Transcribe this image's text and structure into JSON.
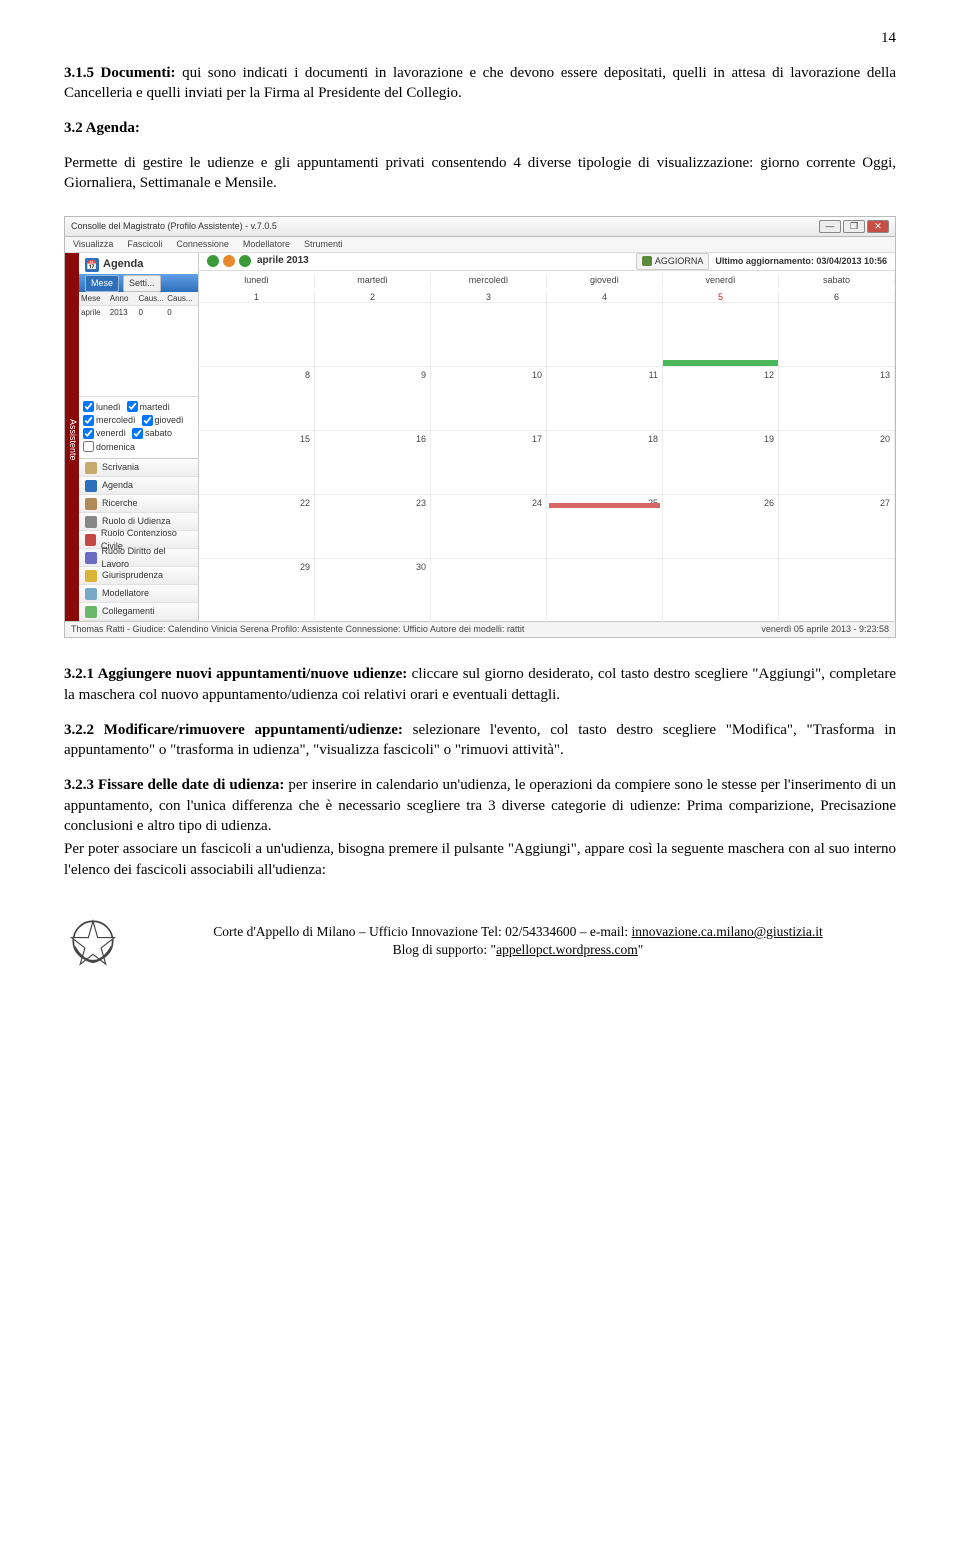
{
  "page_number": "14",
  "s315": {
    "title": "3.1.5 Documenti:",
    "text": " qui sono indicati i documenti in lavorazione e che devono essere depositati, quelli in attesa di lavorazione della Cancelleria e quelli inviati per la Firma al Presidente del Collegio."
  },
  "s32": {
    "title": "3.2 Agenda:",
    "text": "Permette di gestire le udienze e gli appuntamenti privati consentendo 4 diverse tipologie di visualizzazione: giorno corrente Oggi, Giornaliera, Settimanale e Mensile."
  },
  "s321": {
    "title": "3.2.1 Aggiungere nuovi appuntamenti/nuove udienze:",
    "text": " cliccare sul giorno desiderato, col tasto destro scegliere \"Aggiungi\", completare la maschera col nuovo appuntamento/udienza coi relativi orari e eventuali dettagli."
  },
  "s322": {
    "title": "3.2.2 Modificare/rimuovere appuntamenti/udienze:",
    "text": " selezionare l'evento, col tasto destro scegliere \"Modifica\", \"Trasforma in appuntamento\" o \"trasforma in udienza\", \"visualizza fascicoli\" o \"rimuovi attività\"."
  },
  "s323": {
    "title": "3.2.3 Fissare delle date di udienza:",
    "p1": " per inserire in calendario un'udienza, le operazioni da compiere sono le stesse per l'inserimento di un appuntamento, con l'unica differenza che è necessario scegliere tra 3 diverse categorie di udienze: Prima comparizione, Precisazione conclusioni e altro tipo di udienza.",
    "p2": "Per poter associare un fascicoli a un'udienza, bisogna premere il pulsante \"Aggiungi\", appare così la seguente maschera con al suo interno l'elenco dei fascicoli associabili all'udienza:"
  },
  "figure": {
    "window_title": "Consolle del Magistrato (Profilo Assistente) - v.7.0.5",
    "menu": [
      "Visualizza",
      "Fascicoli",
      "Connessione",
      "Modellatore",
      "Strumenti"
    ],
    "side_label": "Assistente",
    "agenda_label": "Agenda",
    "mese_btn": "Mese",
    "sett_btn": "Setti...",
    "left_cols": [
      "Mese",
      "Anno",
      "Caus...",
      "Caus..."
    ],
    "left_row": [
      "aprile",
      "2013",
      "0",
      "0"
    ],
    "days_check": [
      [
        "lunedì",
        "martedì"
      ],
      [
        "mercoledì",
        "giovedì"
      ],
      [
        "venerdì",
        "sabato"
      ],
      [
        "domenica",
        ""
      ]
    ],
    "nav_items": [
      {
        "label": "Scrivania",
        "cls": "ic-scriv"
      },
      {
        "label": "Agenda",
        "cls": "ic-ag"
      },
      {
        "label": "Ricerche",
        "cls": "ic-ric"
      },
      {
        "label": "Ruolo di Udienza",
        "cls": "ic-ruolo"
      },
      {
        "label": "Ruolo Contenzioso Civile",
        "cls": "ic-rcc"
      },
      {
        "label": "Ruolo Diritto del Lavoro",
        "cls": "ic-rdl"
      },
      {
        "label": "Giurisprudenza",
        "cls": "ic-giur"
      },
      {
        "label": "Modellatore",
        "cls": "ic-mod"
      },
      {
        "label": "Collegamenti",
        "cls": "ic-coll"
      }
    ],
    "month_label": "aprile 2013",
    "aggiorna_btn": "AGGIORNA",
    "last_update_label": "Ultimo aggiornamento:",
    "last_update_value": "03/04/2013 10:56",
    "week_days": [
      "lunedì",
      "martedì",
      "mercoledì",
      "giovedì",
      "venerdì",
      "sabato"
    ],
    "week_nums": [
      [
        "1",
        "2",
        "3",
        "4",
        "5",
        "6"
      ],
      [
        "8",
        "9",
        "10",
        "11",
        "12",
        "13"
      ],
      [
        "15",
        "16",
        "17",
        "18",
        "19",
        "20"
      ],
      [
        "22",
        "23",
        "24",
        "25",
        "26",
        "27"
      ],
      [
        "29",
        "30",
        "",
        "",
        "",
        ""
      ]
    ],
    "status_left": "Thomas Ratti - Giudice: Calendino Vinicia Serena   Profilo: Assistente    Connessione: Ufficio   Autore dei modelli: rattit",
    "status_right": "venerdì 05 aprile 2013 - 9:23:58"
  },
  "footer": {
    "line1_a": "Corte d'Appello di Milano – Ufficio Innovazione   Tel: 02/54334600 – e-mail: ",
    "email": "innovazione.ca.milano@giustizia.it",
    "line2_a": "Blog di supporto: \"",
    "blog": "appellopct.wordpress.com",
    "line2_b": "\""
  }
}
